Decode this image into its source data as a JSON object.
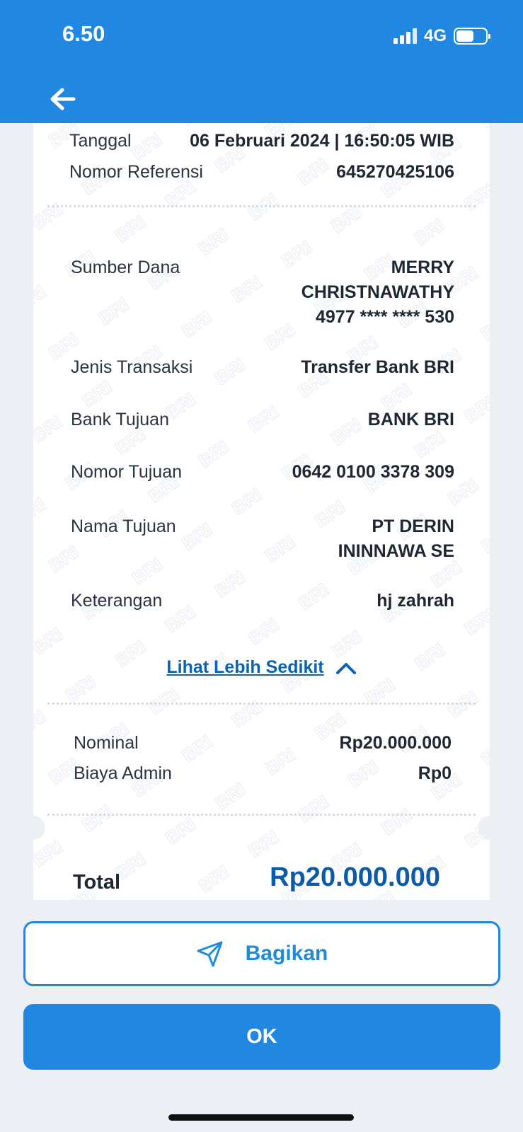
{
  "status_bar": {
    "time": "6.50",
    "network": "4G"
  },
  "header": {
    "back_icon": "arrow-left-icon"
  },
  "receipt": {
    "top_rows": [
      {
        "label": "Tanggal",
        "value": "06 Februari 2024 | 16:50:05 WIB"
      },
      {
        "label": "Nomor Referensi",
        "value": "645270425106"
      }
    ],
    "source": {
      "label": "Sumber Dana",
      "name_line1": "MERRY",
      "name_line2": "CHRISTNAWATHY",
      "account": "4977 **** **** 530"
    },
    "details": [
      {
        "label": "Jenis Transaksi",
        "value": "Transfer Bank BRI"
      },
      {
        "label": "Bank Tujuan",
        "value": "BANK BRI"
      },
      {
        "label": "Nomor Tujuan",
        "value": "0642 0100 3378 309"
      }
    ],
    "recipient": {
      "label": "Nama Tujuan",
      "line1": "PT DERIN",
      "line2": "ININNAWA SE"
    },
    "note": {
      "label": "Keterangan",
      "value": "hj zahrah"
    },
    "toggle_label": "Lihat Lebih Sedikit",
    "amounts": [
      {
        "label": "Nominal",
        "value": "Rp20.000.000"
      },
      {
        "label": "Biaya Admin",
        "value": "Rp0"
      }
    ],
    "total_label": "Total",
    "total_value": "Rp20.000.000",
    "watermark_text": "BRI"
  },
  "actions": {
    "share_label": "Bagikan",
    "ok_label": "OK"
  },
  "colors": {
    "brand_blue": "#2187E0",
    "link_blue": "#0B63B4",
    "total_blue": "#0B5BA8"
  }
}
